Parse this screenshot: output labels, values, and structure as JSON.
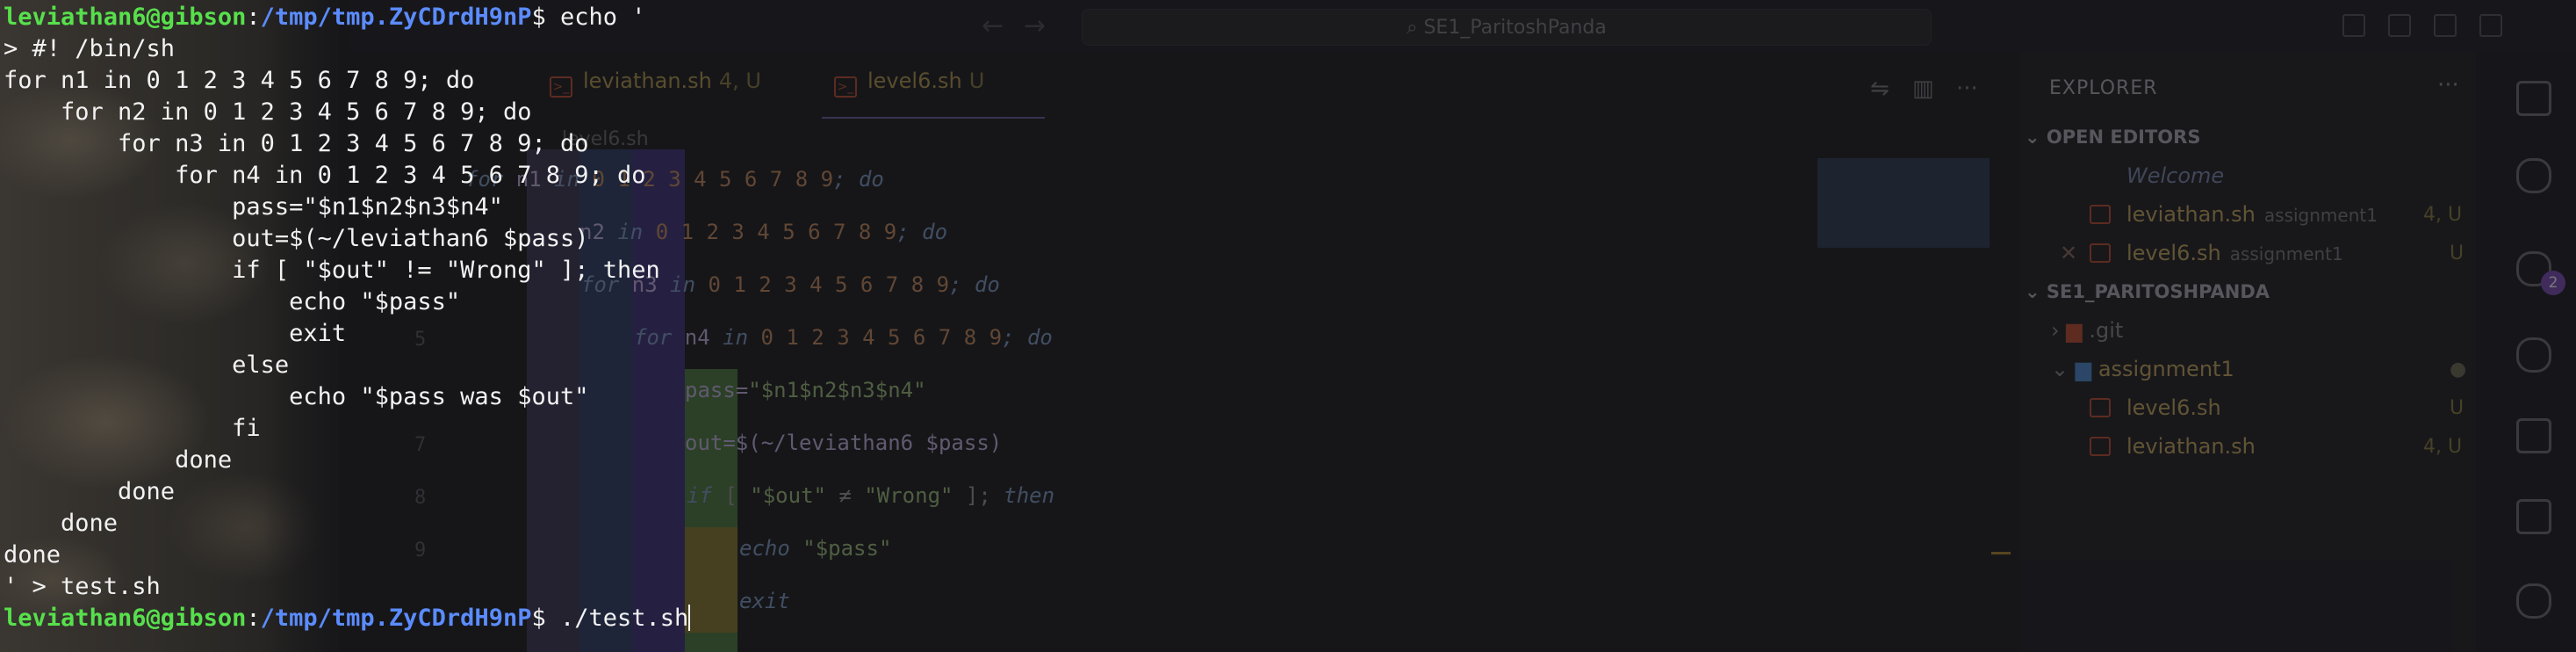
{
  "editor": {
    "search_text": "SE1_ParitoshPanda",
    "tabs": [
      {
        "label": "leviathan.sh",
        "badge": "4, U"
      },
      {
        "label": "level6.sh",
        "badge": "U"
      }
    ],
    "breadcrumb": "level6.sh",
    "line_numbers": [
      "5",
      "7",
      "8",
      "9"
    ],
    "code": {
      "l_n1": {
        "kw1": "for",
        "var": " n1 ",
        "kw2": "in",
        "nums": " 0 1 2 3 4 5 6 7 8 9",
        "end": "; do"
      },
      "l_n2": {
        "var": "n2 ",
        "kw2": "in",
        "nums": " 0 1 2 3 4 5 6 7 8 9",
        "end": "; do"
      },
      "l_n3": {
        "kw1": "for",
        "var": " n3 ",
        "kw2": "in",
        "nums": " 0 1 2 3 4 5 6 7 8 9",
        "end": "; do"
      },
      "l_n4": {
        "kw1": "for",
        "var": " n4 ",
        "kw2": "in",
        "nums": " 0 1 2 3 4 5 6 7 8 9",
        "end": "; do"
      },
      "l_pass": {
        "a": "pass=",
        "b": "\"$n1$n2$n3$n4\""
      },
      "l_out": {
        "a": "out=$(~/leviathan6 $pass)"
      },
      "l_if": {
        "kw": "if",
        "a": " [ ",
        "b": "\"$out\"",
        "c": " ≠ ",
        "d": "\"Wrong\"",
        "e": " ]; ",
        "kw2": "then"
      },
      "l_echo": {
        "kw": "echo",
        "b": " \"$pass\""
      },
      "l_exit": {
        "kw": "exit"
      }
    }
  },
  "explorer": {
    "title": "EXPLORER",
    "more": "···",
    "open_editors_label": "OPEN EDITORS",
    "open_editors": [
      {
        "name": "Welcome",
        "desc": "",
        "status": ""
      },
      {
        "name": "leviathan.sh",
        "desc": "assignment1",
        "status": "4, U"
      },
      {
        "name": "level6.sh",
        "desc": "assignment1",
        "status": "U"
      }
    ],
    "project_label": "SE1_PARITOSHPANDA",
    "tree": [
      {
        "name": ".git",
        "status": ""
      },
      {
        "name": "assignment1",
        "status": "●"
      },
      {
        "name": "level6.sh",
        "status": "U"
      },
      {
        "name": "leviathan.sh",
        "status": "4, U"
      }
    ],
    "scm_badge": "2"
  },
  "terminal": {
    "prompt_user": "leviathan6@gibson",
    "prompt_sep": ":",
    "prompt_path": "/tmp/tmp.ZyCDrdH9nP",
    "prompt_end": "$ ",
    "command1": "echo '",
    "heredoc": [
      "> #! /bin/sh",
      "for n1 in 0 1 2 3 4 5 6 7 8 9; do",
      "    for n2 in 0 1 2 3 4 5 6 7 8 9; do",
      "        for n3 in 0 1 2 3 4 5 6 7 8 9; do",
      "            for n4 in 0 1 2 3 4 5 6 7 8 9; do",
      "                pass=\"$n1$n2$n3$n4\"",
      "                out=$(~/leviathan6 $pass)",
      "                if [ \"$out\" != \"Wrong\" ]; then",
      "                    echo \"$pass\"",
      "                    exit",
      "                else",
      "                    echo \"$pass was $out\"",
      "                fi",
      "            done",
      "        done",
      "    done",
      "done",
      "' > test.sh"
    ],
    "command2": "./test.sh"
  },
  "colors": {
    "prompt_user": "#57e04c",
    "prompt_path": "#5b8cff",
    "terminal_text": "#f2f2f2",
    "background": "#161619"
  }
}
